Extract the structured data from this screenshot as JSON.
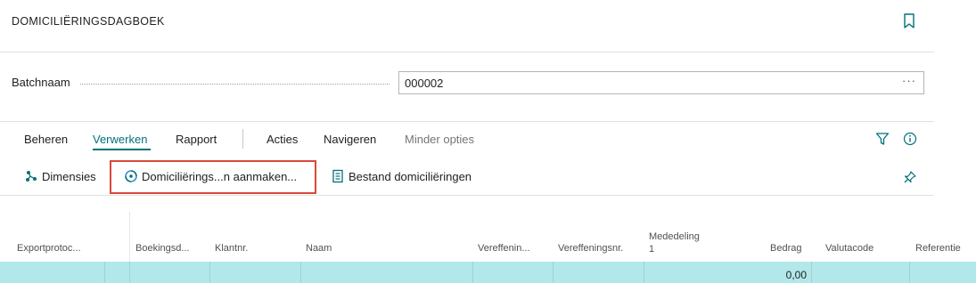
{
  "page": {
    "title": "DOMICILIËRINGSDAGBOEK"
  },
  "batch": {
    "label": "Batchnaam",
    "value": "000002",
    "more": "···"
  },
  "tabs": {
    "items": [
      {
        "label": "Beheren"
      },
      {
        "label": "Verwerken"
      },
      {
        "label": "Rapport"
      },
      {
        "label": "Acties"
      },
      {
        "label": "Navigeren"
      },
      {
        "label": "Minder opties"
      }
    ]
  },
  "actions": {
    "dimensions": "Dimensies",
    "create": "Domiciliërings...n aanmaken...",
    "file": "Bestand domiciliëringen"
  },
  "grid": {
    "columns": [
      {
        "label": "Exportprotoc..."
      },
      {
        "label": "Boekingsd..."
      },
      {
        "label": "Klantnr."
      },
      {
        "label": "Naam"
      },
      {
        "label": "Vereffenin..."
      },
      {
        "label": "Vereffeningsnr."
      },
      {
        "label": "Mededeling",
        "label2": "1"
      },
      {
        "label": "Bedrag"
      },
      {
        "label": "Valutacode"
      },
      {
        "label": "Referentie"
      }
    ],
    "rows": [
      {
        "amount": "0,00"
      }
    ]
  },
  "colors": {
    "accent": "#00717a",
    "highlight": "#d9473a",
    "selected_row": "#b2e8ea"
  }
}
